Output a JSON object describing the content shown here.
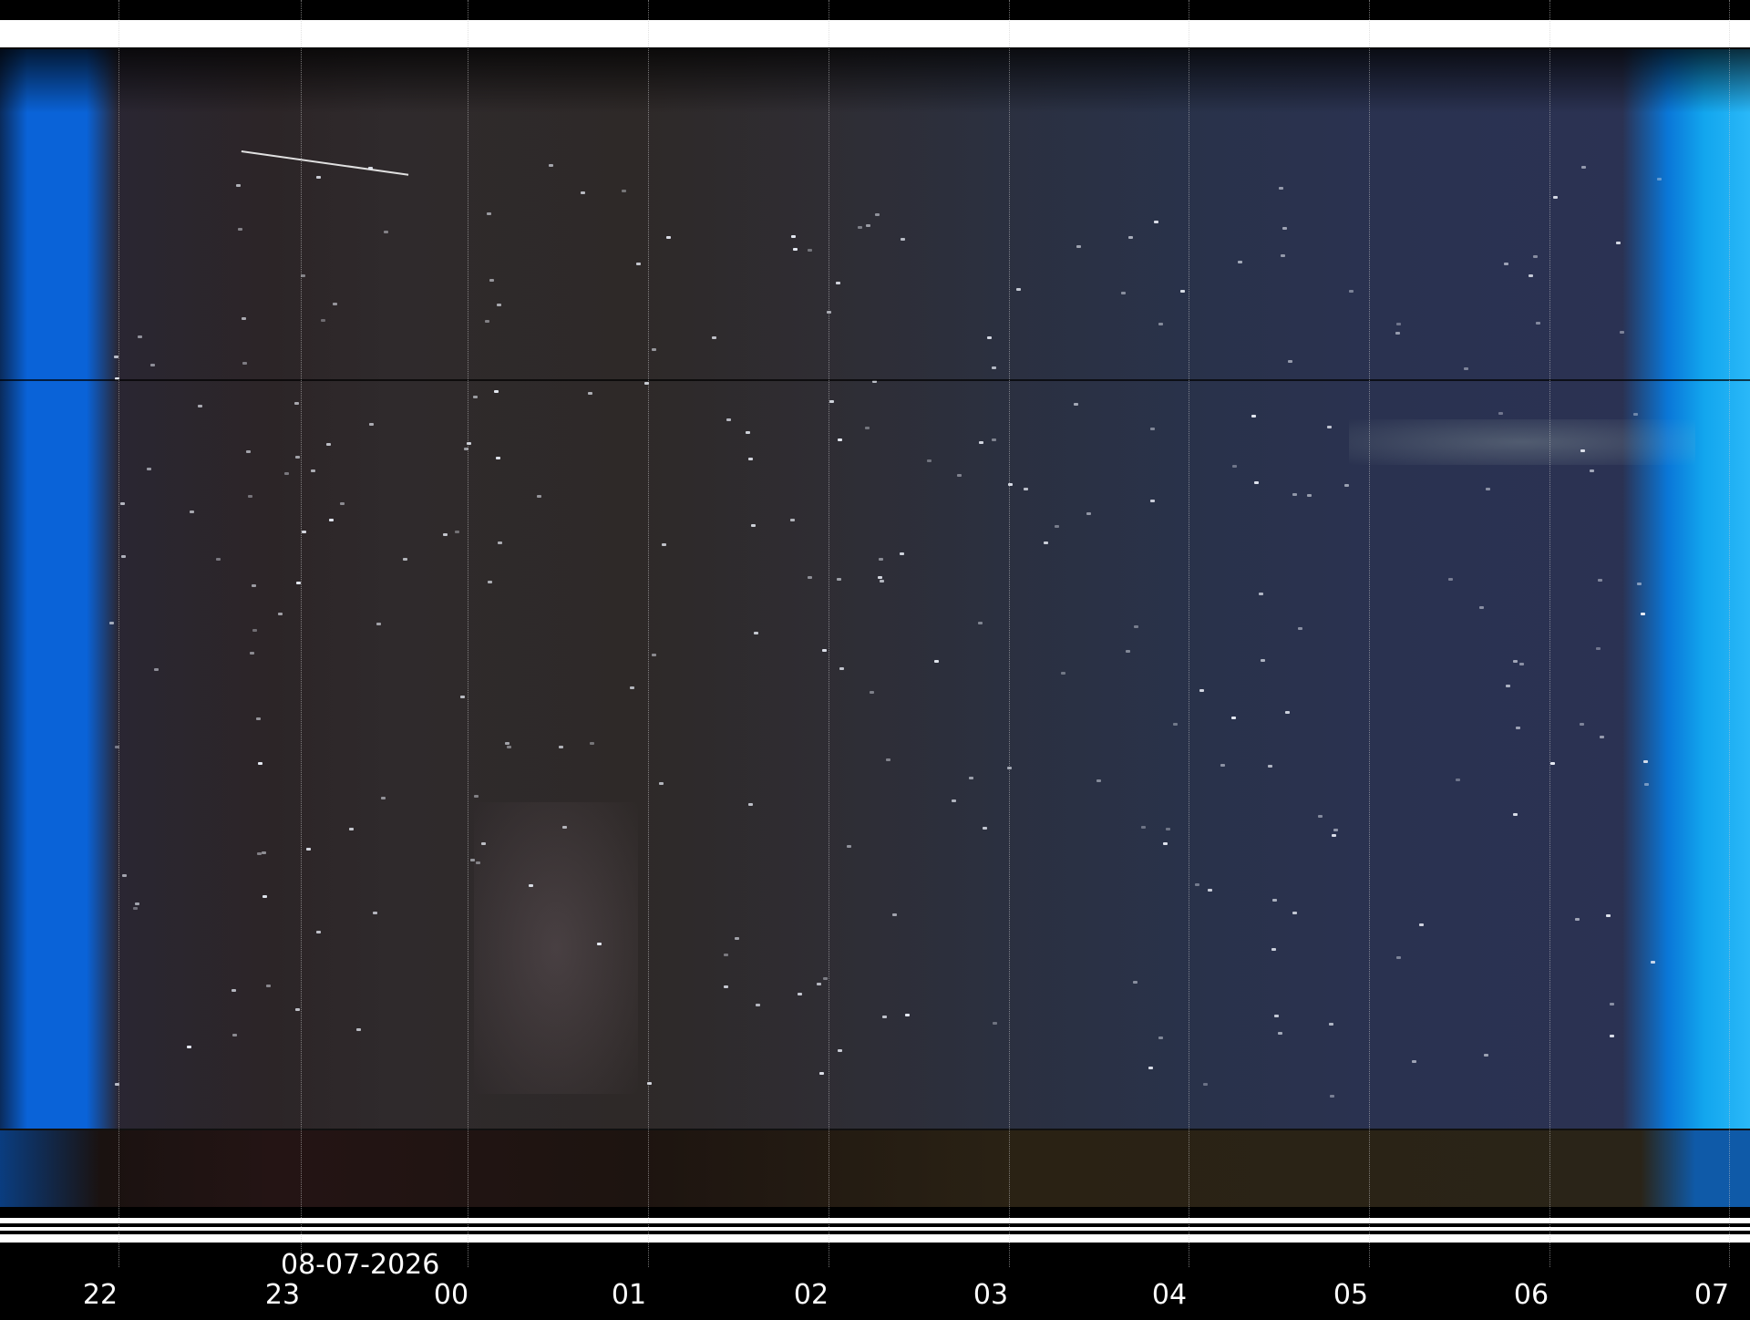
{
  "date_label": "08-07-2026",
  "hours": [
    "22",
    "23",
    "00",
    "01",
    "02",
    "03",
    "04",
    "05",
    "06",
    "07"
  ],
  "colors": {
    "twilight": "#0a63d8",
    "night_sky": "#2c2527",
    "background": "#000000",
    "axis_text": "#ffffff"
  }
}
